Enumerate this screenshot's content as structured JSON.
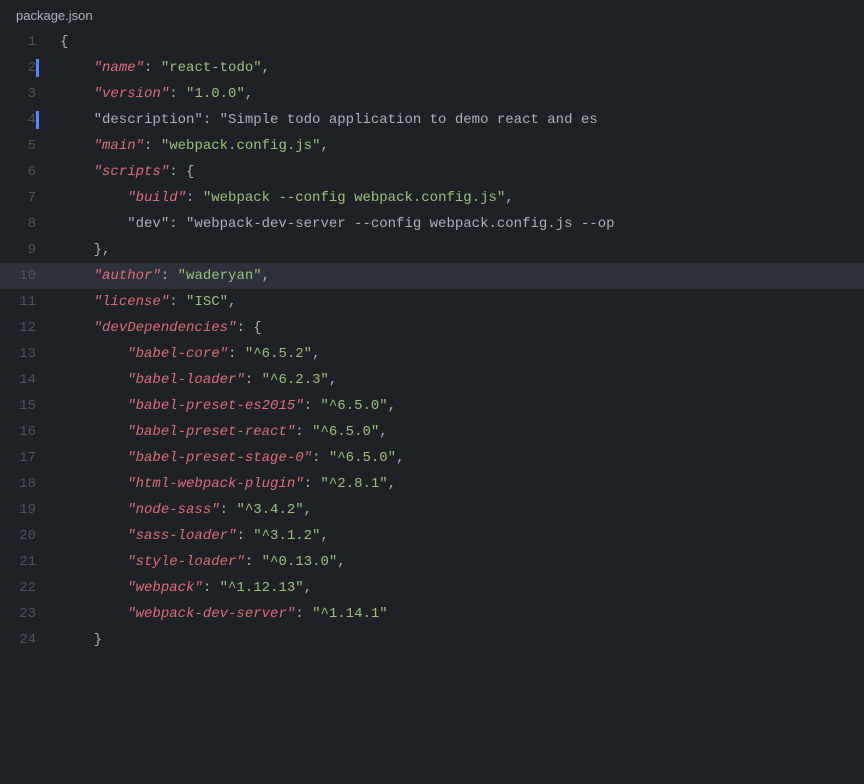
{
  "title": "package.json",
  "colors": {
    "bg": "#1e2227",
    "lineHighlight": "#2c313c",
    "lineNumber": "#4b5263",
    "key": "#e06c75",
    "stringValue": "#98c379",
    "punctuation": "#abb2bf",
    "activeIndicator": "#528bff"
  },
  "lines": [
    {
      "num": 1,
      "content": "{",
      "indicator": false,
      "highlighted": false
    },
    {
      "num": 2,
      "content": "    \"name\": \"react-todo\",",
      "indicator": true,
      "highlighted": false
    },
    {
      "num": 3,
      "content": "    \"version\": \"1.0.0\",",
      "indicator": false,
      "highlighted": false
    },
    {
      "num": 4,
      "content": "    \"description\": \"Simple todo application to demo react and es",
      "indicator": true,
      "highlighted": false
    },
    {
      "num": 5,
      "content": "    \"main\": \"webpack.config.js\",",
      "indicator": false,
      "highlighted": false
    },
    {
      "num": 6,
      "content": "    \"scripts\": {",
      "indicator": false,
      "highlighted": false
    },
    {
      "num": 7,
      "content": "        \"build\": \"webpack --config webpack.config.js\",",
      "indicator": false,
      "highlighted": false
    },
    {
      "num": 8,
      "content": "        \"dev\": \"webpack-dev-server --config webpack.config.js --op",
      "indicator": false,
      "highlighted": false
    },
    {
      "num": 9,
      "content": "    },",
      "indicator": false,
      "highlighted": false
    },
    {
      "num": 10,
      "content": "    \"author\": \"waderyan\",",
      "indicator": false,
      "highlighted": true
    },
    {
      "num": 11,
      "content": "    \"license\": \"ISC\",",
      "indicator": false,
      "highlighted": false
    },
    {
      "num": 12,
      "content": "    \"devDependencies\": {",
      "indicator": false,
      "highlighted": false
    },
    {
      "num": 13,
      "content": "        \"babel-core\": \"^6.5.2\",",
      "indicator": false,
      "highlighted": false
    },
    {
      "num": 14,
      "content": "        \"babel-loader\": \"^6.2.3\",",
      "indicator": false,
      "highlighted": false
    },
    {
      "num": 15,
      "content": "        \"babel-preset-es2015\": \"^6.5.0\",",
      "indicator": false,
      "highlighted": false
    },
    {
      "num": 16,
      "content": "        \"babel-preset-react\": \"^6.5.0\",",
      "indicator": false,
      "highlighted": false
    },
    {
      "num": 17,
      "content": "        \"babel-preset-stage-0\": \"^6.5.0\",",
      "indicator": false,
      "highlighted": false
    },
    {
      "num": 18,
      "content": "        \"html-webpack-plugin\": \"^2.8.1\",",
      "indicator": false,
      "highlighted": false
    },
    {
      "num": 19,
      "content": "        \"node-sass\": \"^3.4.2\",",
      "indicator": false,
      "highlighted": false
    },
    {
      "num": 20,
      "content": "        \"sass-loader\": \"^3.1.2\",",
      "indicator": false,
      "highlighted": false
    },
    {
      "num": 21,
      "content": "        \"style-loader\": \"^0.13.0\",",
      "indicator": false,
      "highlighted": false
    },
    {
      "num": 22,
      "content": "        \"webpack\": \"^1.12.13\",",
      "indicator": false,
      "highlighted": false
    },
    {
      "num": 23,
      "content": "        \"webpack-dev-server\": \"^1.14.1\"",
      "indicator": false,
      "highlighted": false
    },
    {
      "num": 24,
      "content": "    }",
      "indicator": false,
      "highlighted": false
    }
  ]
}
